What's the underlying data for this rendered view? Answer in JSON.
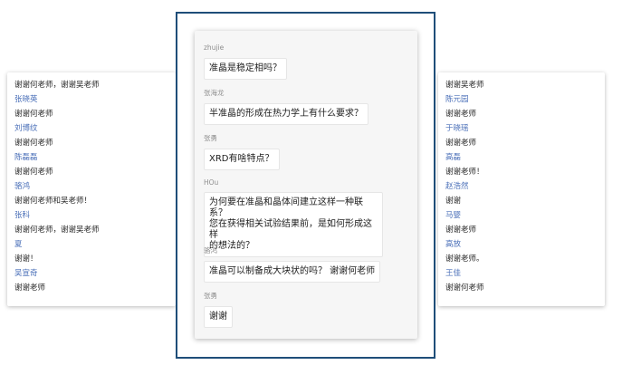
{
  "left_panel": {
    "rows": [
      {
        "type": "msg",
        "text": "谢谢何老师，谢谢吴老师"
      },
      {
        "type": "name",
        "text": "张晓英"
      },
      {
        "type": "msg",
        "text": "谢谢何老师"
      },
      {
        "type": "name",
        "text": "刘博纹"
      },
      {
        "type": "msg",
        "text": "谢谢何老师"
      },
      {
        "type": "name",
        "text": "陈磊磊"
      },
      {
        "type": "msg",
        "text": "谢谢何老师"
      },
      {
        "type": "name",
        "text": "骆鸿"
      },
      {
        "type": "msg",
        "text": "谢谢何老师和吴老师！"
      },
      {
        "type": "name",
        "text": "张科"
      },
      {
        "type": "msg",
        "text": "谢谢何老师，谢谢吴老师"
      },
      {
        "type": "name",
        "text": "夏"
      },
      {
        "type": "msg",
        "text": "谢谢！"
      },
      {
        "type": "name",
        "text": "吴宣奇"
      },
      {
        "type": "msg",
        "text": "谢谢老师"
      }
    ]
  },
  "center_chat": {
    "messages": [
      {
        "sender": "zhujie",
        "text": "准晶是稳定相吗？"
      },
      {
        "sender": "张海龙",
        "text": "半准晶的形成在热力学上有什么要求？"
      },
      {
        "sender": "张勇",
        "text": "XRD有啥特点？"
      },
      {
        "sender": "HOu",
        "text": "为何要在准晶和晶体间建立这样一种联系？\n您在获得相关试验结果前，是如何形成这样\n的想法的？"
      },
      {
        "sender": "骆鸿",
        "text": "准晶可以制备成大块状的吗？ 谢谢何老师"
      },
      {
        "sender": "张勇",
        "text": "谢谢"
      }
    ]
  },
  "right_panel": {
    "rows": [
      {
        "type": "msg",
        "text": "谢谢吴老师"
      },
      {
        "type": "name",
        "text": "陈元园"
      },
      {
        "type": "msg",
        "text": "谢谢老师"
      },
      {
        "type": "name",
        "text": "于晓瑶"
      },
      {
        "type": "msg",
        "text": "谢谢老师"
      },
      {
        "type": "name",
        "text": "高磊"
      },
      {
        "type": "msg",
        "text": "谢谢老师！"
      },
      {
        "type": "name",
        "text": "赵浩然"
      },
      {
        "type": "msg",
        "text": "谢谢"
      },
      {
        "type": "name",
        "text": "马婴"
      },
      {
        "type": "msg",
        "text": "谢谢老师"
      },
      {
        "type": "name",
        "text": "高放"
      },
      {
        "type": "msg",
        "text": "谢谢老师。"
      },
      {
        "type": "name",
        "text": "王佳"
      },
      {
        "type": "msg",
        "text": "谢谢何老师"
      }
    ]
  }
}
